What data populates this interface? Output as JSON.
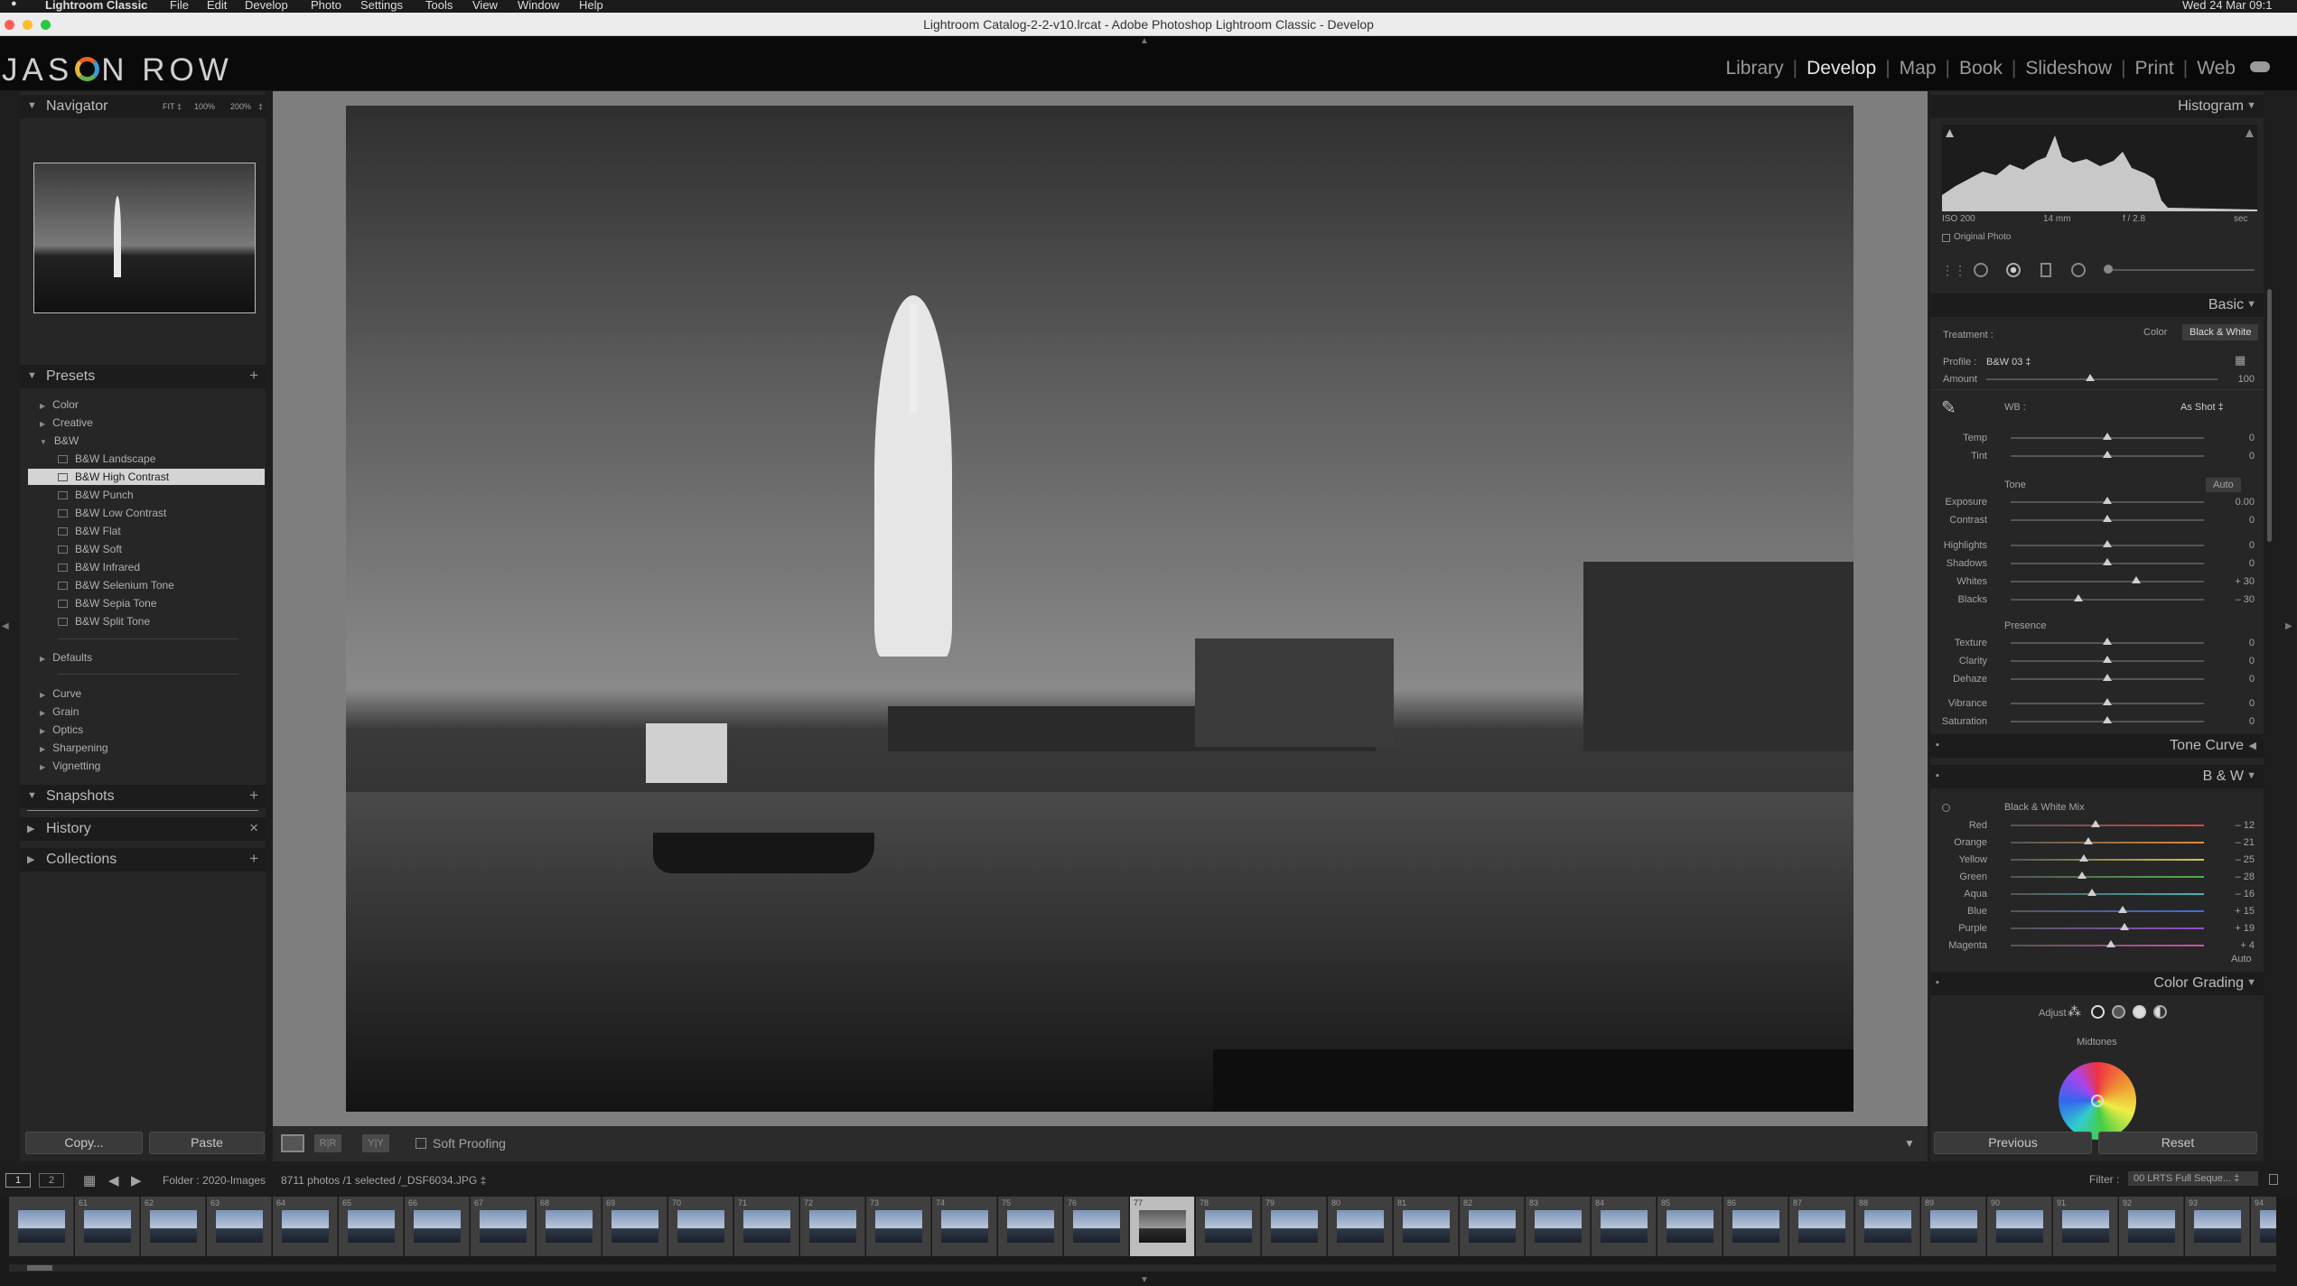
{
  "colors": {
    "accent": "#e6e6e6",
    "panel": "#262626",
    "header": "#1c1c1c",
    "selection": "#d4d4d4",
    "stage": "#7e7e7e"
  },
  "menubar": {
    "app": "Lightroom Classic",
    "items": [
      "File",
      "Edit",
      "Develop",
      "Photo",
      "Settings",
      "Tools",
      "View",
      "Window",
      "Help"
    ],
    "clock": "Wed 24 Mar 09:1"
  },
  "window": {
    "title": "Lightroom Catalog-2-2-v10.lrcat - Adobe Photoshop Lightroom Classic - Develop"
  },
  "identity": {
    "logo_prefix": "JAS",
    "logo_suffix": "N ROW"
  },
  "modules": {
    "items": [
      "Library",
      "Develop",
      "Map",
      "Book",
      "Slideshow",
      "Print",
      "Web"
    ],
    "active": "Develop",
    "cloud_icon": "cloud-icon"
  },
  "navigator": {
    "title": "Navigator",
    "zoom_fit": "FIT ‡",
    "zoom_100": "100%",
    "zoom_200": "200%",
    "zoom_arrow": "‡"
  },
  "presets": {
    "title": "Presets",
    "add": "+",
    "groups": [
      "Color",
      "Creative",
      "B&W"
    ],
    "bw_items": [
      "B&W Landscape",
      "B&W High Contrast",
      "B&W Punch",
      "B&W Low Contrast",
      "B&W Flat",
      "B&W Soft",
      "B&W Infrared",
      "B&W Selenium Tone",
      "B&W Sepia Tone",
      "B&W Split Tone"
    ],
    "selected_index": 1,
    "defaults": "Defaults",
    "extra_groups": [
      "Curve",
      "Grain",
      "Optics",
      "Sharpening",
      "Vignetting"
    ]
  },
  "snapshots": {
    "title": "Snapshots",
    "add": "+"
  },
  "history": {
    "title": "History",
    "clear": "×"
  },
  "collections": {
    "title": "Collections",
    "add": "+"
  },
  "left_buttons": {
    "copy": "Copy...",
    "paste": "Paste"
  },
  "histogram": {
    "title": "Histogram",
    "iso": "ISO 200",
    "focal": "14 mm",
    "aperture": "f / 2.8",
    "shutter": "sec",
    "original_photo": "Original Photo"
  },
  "basic": {
    "title": "Basic",
    "treatment_label": "Treatment :",
    "treatment_color": "Color",
    "treatment_bw": "Black & White",
    "profile_label": "Profile :",
    "profile_value": "B&W 03 ‡",
    "amount_label": "Amount",
    "amount_value": "100",
    "amount_level": 0.45,
    "wb_label": "WB :",
    "wb_value": "As Shot ‡",
    "wb_sliders": [
      {
        "label": "Temp",
        "value": "0",
        "level": 0.5
      },
      {
        "label": "Tint",
        "value": "0",
        "level": 0.5
      }
    ],
    "tone_label": "Tone",
    "tone_auto": "Auto",
    "tone_sliders": [
      {
        "label": "Exposure",
        "value": "0.00",
        "level": 0.5
      },
      {
        "label": "Contrast",
        "value": "0",
        "level": 0.5
      },
      {
        "label": "Highlights",
        "value": "0",
        "level": 0.5
      },
      {
        "label": "Shadows",
        "value": "0",
        "level": 0.5
      },
      {
        "label": "Whites",
        "value": "+ 30",
        "level": 0.65
      },
      {
        "label": "Blacks",
        "value": "– 30",
        "level": 0.35
      }
    ],
    "presence_label": "Presence",
    "presence_sliders": [
      {
        "label": "Texture",
        "value": "0",
        "level": 0.5
      },
      {
        "label": "Clarity",
        "value": "0",
        "level": 0.5
      },
      {
        "label": "Dehaze",
        "value": "0",
        "level": 0.5
      },
      {
        "label": "Vibrance",
        "value": "0",
        "level": 0.5
      },
      {
        "label": "Saturation",
        "value": "0",
        "level": 0.5
      }
    ]
  },
  "tone_curve": {
    "title": "Tone Curve"
  },
  "bw": {
    "title": "B & W",
    "mix_label": "Black & White Mix",
    "auto": "Auto",
    "sliders": [
      {
        "label": "Red",
        "value": "– 12",
        "level": 0.44,
        "color": "#d9453f"
      },
      {
        "label": "Orange",
        "value": "– 21",
        "level": 0.4,
        "color": "#e38a35"
      },
      {
        "label": "Yellow",
        "value": "– 25",
        "level": 0.38,
        "color": "#d9c83f"
      },
      {
        "label": "Green",
        "value": "– 28",
        "level": 0.37,
        "color": "#4fb04a"
      },
      {
        "label": "Aqua",
        "value": "– 16",
        "level": 0.42,
        "color": "#3fb6b6"
      },
      {
        "label": "Blue",
        "value": "+ 15",
        "level": 0.58,
        "color": "#3f6fd9"
      },
      {
        "label": "Purple",
        "value": "+ 19",
        "level": 0.59,
        "color": "#8f4fd0"
      },
      {
        "label": "Magenta",
        "value": "+ 4",
        "level": 0.52,
        "color": "#d04fa6"
      }
    ]
  },
  "color_grading": {
    "title": "Color Grading",
    "adjust_label": "Adjust :",
    "midtones": "Midtones"
  },
  "right_buttons": {
    "previous": "Previous",
    "reset": "Reset"
  },
  "toolbar": {
    "soft_proofing": "Soft Proofing"
  },
  "filmbar": {
    "page1": "1",
    "page2": "2",
    "folder": "Folder : 2020-Images",
    "info": "8711 photos /1 selected /_DSF6034.JPG ‡",
    "filter_label": "Filter :",
    "filter_value": "00 LRTS Full Seque...  ‡"
  },
  "filmstrip": {
    "numbers": [
      "",
      "61",
      "62",
      "63",
      "64",
      "65",
      "66",
      "67",
      "68",
      "69",
      "70",
      "71",
      "72",
      "73",
      "74",
      "75",
      "76",
      "77",
      "78",
      "79",
      "80",
      "81",
      "82",
      "83",
      "84",
      "85",
      "86",
      "87",
      "88",
      "89",
      "90",
      "91",
      "92",
      "93",
      "94"
    ],
    "selected_index": 17
  }
}
